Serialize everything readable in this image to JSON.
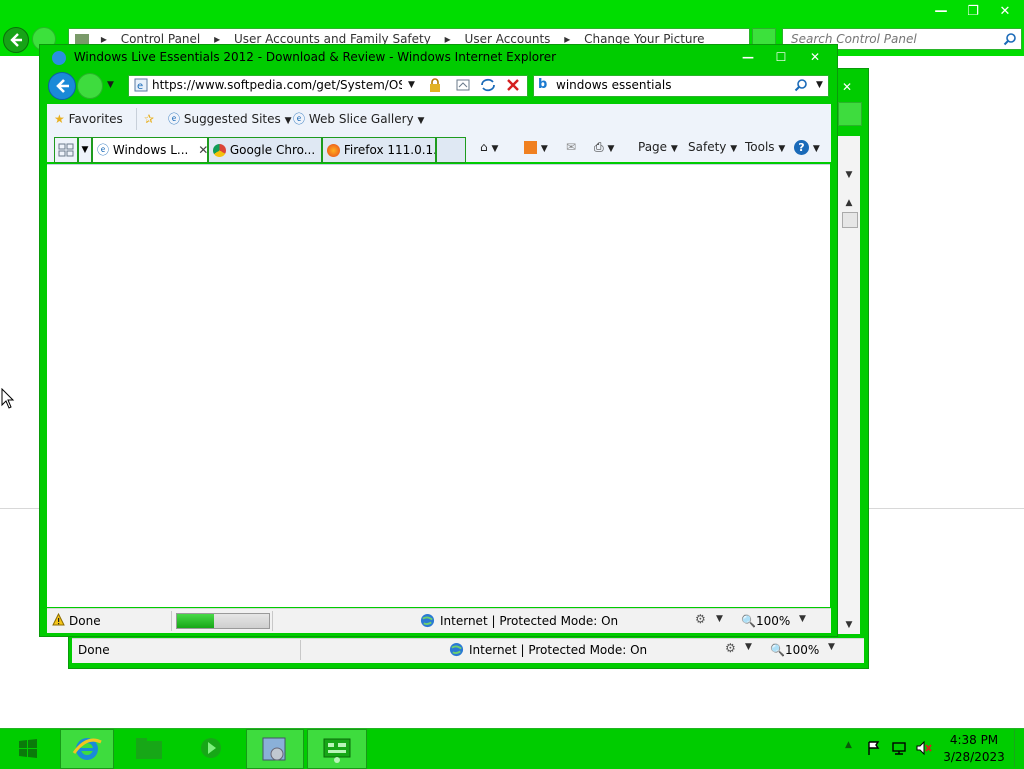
{
  "control_panel": {
    "address_crumbs": [
      "Control Panel",
      "User Accounts and Family Safety",
      "User Accounts",
      "Change Your Picture"
    ],
    "search_placeholder": "Search Control Panel"
  },
  "ie_window": {
    "title": "Windows Live Essentials 2012 - Download & Review - Windows Internet Explorer",
    "address_url": "https://www.softpedia.com/get/System/OS-En",
    "search_text": "windows essentials",
    "favorites_label": "Favorites",
    "suggested_sites_label": "Suggested Sites",
    "web_slice_gallery_label": "Web Slice Gallery",
    "tabs": [
      {
        "label": "Windows L..."
      },
      {
        "label": "Google Chro..."
      },
      {
        "label": "Firefox 111.0.1..."
      }
    ],
    "commands": {
      "page": "Page",
      "safety": "Safety",
      "tools": "Tools"
    },
    "status": {
      "text": "Done",
      "zone": "Internet | Protected Mode: On",
      "zoom": "100%",
      "progress": 0.4
    }
  },
  "ie_window_back": {
    "status": {
      "text": "Done",
      "zone": "Internet | Protected Mode: On",
      "zoom": "100%"
    }
  },
  "taskbar": {
    "time": "4:38 PM",
    "date": "3/28/2023"
  },
  "colors": {
    "accent": "#00cc00",
    "ie_blue": "#1a8ad8"
  }
}
